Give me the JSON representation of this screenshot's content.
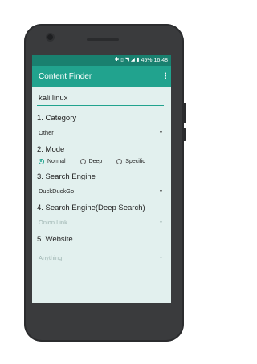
{
  "status_bar": {
    "icons": [
      "bluetooth-icon",
      "vibrate-icon",
      "wifi-icon",
      "signal-icon"
    ],
    "battery": "45%",
    "time": "16:48"
  },
  "app_bar": {
    "title": "Content Finder",
    "menu_icon": "overflow-menu-icon"
  },
  "search": {
    "value": "kali linux"
  },
  "category": {
    "label": "1. Category",
    "selected": "Other"
  },
  "mode": {
    "label": "2. Mode",
    "options": [
      "Normal",
      "Deep",
      "Specific"
    ],
    "selected": "Normal"
  },
  "search_engine": {
    "label": "3. Search Engine",
    "selected": "DuckDuckGo"
  },
  "deep_search_engine": {
    "label": "4. Search Engine(Deep Search)",
    "selected": "Onion Link"
  },
  "website": {
    "label": "5. Website",
    "selected": "Anything"
  },
  "colors": {
    "primary": "#21a38e",
    "primary_dark": "#19806f",
    "background": "#e2f0ee"
  }
}
